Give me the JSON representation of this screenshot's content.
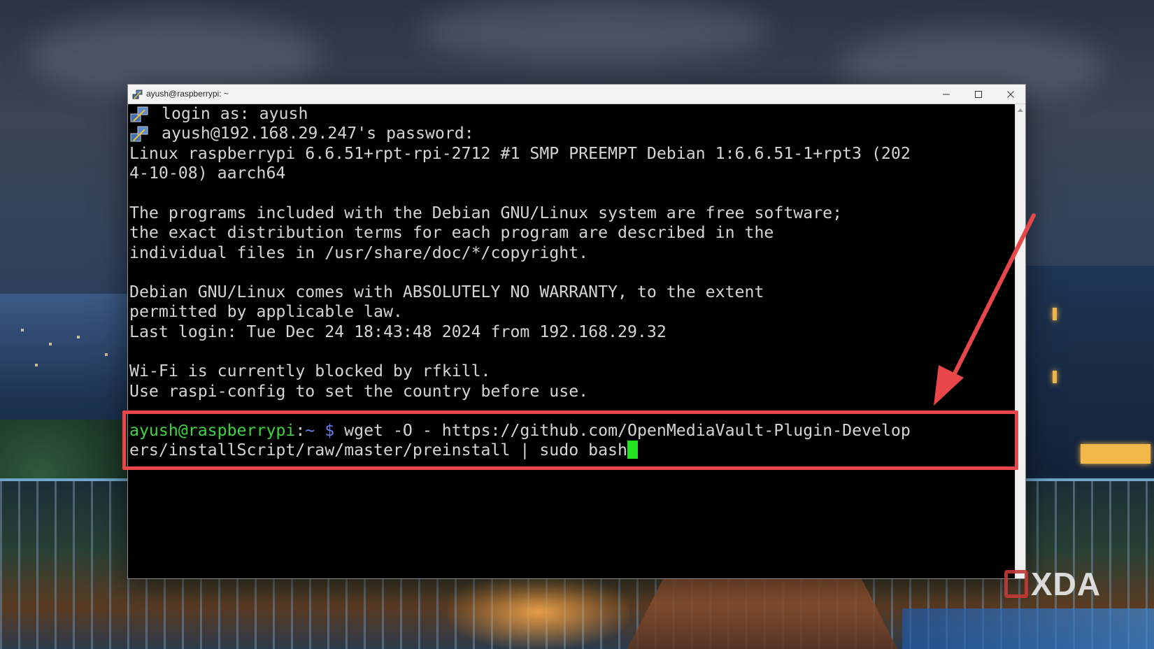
{
  "window": {
    "title": "ayush@raspberrypi: ~"
  },
  "terminal": {
    "lines": [
      "login as: ayush",
      "ayush@192.168.29.247's password:",
      "Linux raspberrypi 6.6.51+rpt-rpi-2712 #1 SMP PREEMPT Debian 1:6.6.51-1+rpt3 (202",
      "4-10-08) aarch64",
      "The programs included with the Debian GNU/Linux system are free software;",
      "the exact distribution terms for each program are described in the",
      "individual files in /usr/share/doc/*/copyright.",
      "Debian GNU/Linux comes with ABSOLUTELY NO WARRANTY, to the extent",
      "permitted by applicable law.",
      "Last login: Tue Dec 24 18:43:48 2024 from 192.168.29.32",
      "Wi-Fi is currently blocked by rfkill.",
      "Use raspi-config to set the country before use."
    ],
    "prompt": {
      "user_host": "ayush@raspberrypi",
      "colon": ":",
      "path": "~ $",
      "command_line1": " wget -O - https://github.com/OpenMediaVault-Plugin-Develop",
      "command_line2": "ers/installScript/raw/master/preinstall | sudo bash"
    }
  },
  "colors": {
    "prompt_user": "#3fd33f",
    "prompt_path": "#6a7df0",
    "cursor": "#22e522",
    "highlight": "#e8474a",
    "terminal_text": "#d4d4d4"
  },
  "watermark": {
    "text": "XDA"
  },
  "icons": {
    "app": "putty-icon",
    "minimize": "minimize-icon",
    "maximize": "maximize-icon",
    "close": "close-icon"
  }
}
